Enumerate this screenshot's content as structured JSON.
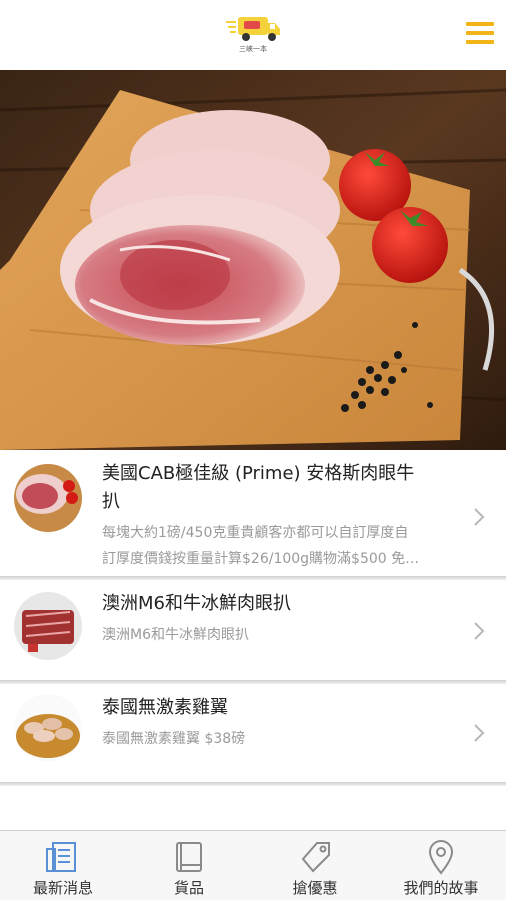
{
  "header": {
    "logo_text": "三峽一本",
    "menu_icon": "hamburger-menu-icon",
    "accent": "#f2b418"
  },
  "hero": {
    "alt": "ribeye steaks on cutting board with tomatoes and peppercorns"
  },
  "products": [
    {
      "title": "美國CAB極佳級 (Prime) 安格斯肉眼牛扒",
      "title_line1": "美國CAB極佳級 (Prime) 安格斯肉眼牛",
      "title_line2": "扒",
      "desc_line1": "每塊大約1磅/450克重貴顧客亦都可以自訂厚度自",
      "desc_line2": "訂厚度價錢按重量計算$26/100g購物滿$500 免…"
    },
    {
      "title": "澳洲M6和牛冰鮮肉眼扒",
      "desc_line1": "澳洲M6和牛冰鮮肉眼扒"
    },
    {
      "title": "泰國無激素雞翼",
      "desc_line1": "泰國無激素雞翼 $38磅"
    }
  ],
  "tabs": [
    {
      "label": "最新消息",
      "icon": "news-icon"
    },
    {
      "label": "貨品",
      "icon": "book-icon"
    },
    {
      "label": "搶優惠",
      "icon": "tag-icon"
    },
    {
      "label": "我們的故事",
      "icon": "location-pin-icon"
    }
  ],
  "colors": {
    "active_tab": "#5b8fd6",
    "inactive_tab": "#8a8a8a",
    "divider": "#d6d6d6"
  }
}
